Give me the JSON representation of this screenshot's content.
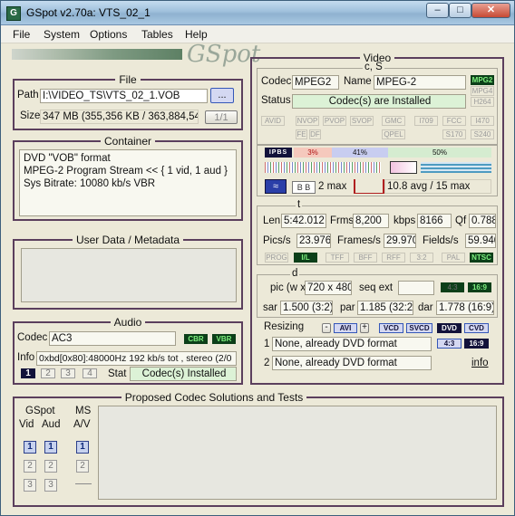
{
  "window": {
    "title": "GSpot v2.70a: VTS_02_1",
    "minimize": "–",
    "maximize": "□",
    "close": "✕"
  },
  "menu": [
    "File",
    "System",
    "Options",
    "Tables",
    "Help"
  ],
  "logo": "GSpot",
  "file": {
    "title": "File",
    "path_label": "Path",
    "path": "I:\\VIDEO_TS\\VTS_02_1.VOB",
    "browse": "...",
    "size_label": "Size",
    "size": "347 MB (355,356 KB / 363,884,544",
    "pages": "1/1"
  },
  "container": {
    "title": "Container",
    "text": "DVD \"VOB\" format\nMPEG-2 Program Stream << { 1 vid, 1 aud }\nSys Bitrate: 10080 kb/s VBR"
  },
  "userdata": {
    "title": "User Data / Metadata"
  },
  "audio": {
    "title": "Audio",
    "codec_label": "Codec",
    "codec": "AC3",
    "cbr": "CBR",
    "vbr": "VBR",
    "info_label": "Info",
    "info": "0xbd[0x80]:48000Hz  192 kb/s tot , stereo (2/0",
    "streams": [
      "1",
      "2",
      "3",
      "4"
    ],
    "stat_label": "Stat",
    "stat": "Codec(s) Installed"
  },
  "proposed": {
    "title": "Proposed Codec Solutions and Tests",
    "gspot": "GSpot",
    "vid": "Vid",
    "aud": "Aud",
    "ms": "MS",
    "av": "A/V",
    "vid_btns": [
      "1",
      "2",
      "3"
    ],
    "aud_btns": [
      "1",
      "2",
      "3"
    ],
    "ms_btns": [
      "1",
      "2"
    ]
  },
  "video": {
    "title": "Video",
    "cs": "c, S",
    "codec_label": "Codec",
    "codec": "MPEG2",
    "name_label": "Name",
    "name": "MPEG-2",
    "status_label": "Status",
    "status": "Codec(s) are Installed",
    "codec_tags": [
      "MPG2",
      "MPG4",
      "H264"
    ],
    "feature_tags": [
      "AVID",
      "NVOP",
      "PVOP",
      "SVOP",
      "GMC",
      "I709",
      "FCC",
      "I470",
      "FE",
      "DF",
      "QPEL",
      "S170",
      "S240"
    ],
    "gop": "IPBS",
    "pct_i": "3%",
    "pct_p": "41%",
    "pct_b": "50%",
    "bframes": "2 max",
    "bitrate": "10.8 avg / 15 max",
    "t": "t",
    "len_label": "Len",
    "len": "5:42.012",
    "frms_label": "Frms",
    "frms": "8,200",
    "kbps_label": "kbps",
    "kbps": "8166",
    "qf_label": "Qf",
    "qf": "0.788",
    "pics_label": "Pics/s",
    "pics": "23.976",
    "frames_label": "Frames/s",
    "frames": "29.970",
    "fields_label": "Fields/s",
    "fields": "59.940",
    "scan_tags": [
      "PROG",
      "I/L",
      "TFF",
      "BFF",
      "RFF",
      "3:2",
      "PAL",
      "NTSC"
    ],
    "d": "d",
    "pic_label": "pic (w x",
    "pic": "720 x 480",
    "seqext_label": "seq ext",
    "ar43": "4:3",
    "ar169": "16:9",
    "sar_label": "sar",
    "sar": "1.500 (3:2)",
    "par_label": "par",
    "par": "1.185 (32:27",
    "dar_label": "dar",
    "dar": "1.778 (16:9)",
    "resizing_label": "Resizing",
    "avi": "AVI",
    "fmt": [
      "VCD",
      "SVCD",
      "DVD",
      "CVD"
    ],
    "r1": "1",
    "r1_text": "None, already DVD format",
    "r1_43": "4:3",
    "r1_169": "16:9",
    "r2": "2",
    "r2_text": "None, already DVD format",
    "info_link": "info"
  },
  "colors": {
    "frame": "#5b3f5d",
    "green_field": "#dcf2d6",
    "tag_on": "#0c3f19"
  }
}
